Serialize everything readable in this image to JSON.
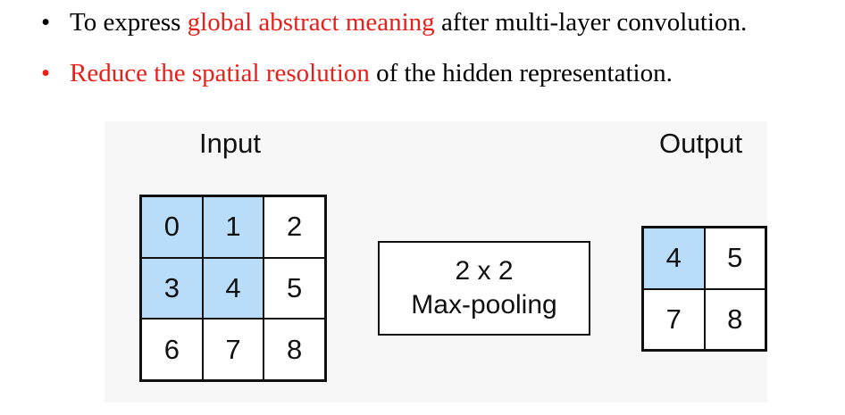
{
  "bullets": [
    {
      "before": "To express ",
      "highlight": "global abstract meaning",
      "after": " after multi-layer convolution."
    },
    {
      "before": "",
      "highlight": "Reduce the spatial resolution",
      "after": " of the hidden representation."
    }
  ],
  "diagram": {
    "input_label": "Input",
    "output_label": "Output",
    "operation_line1": "2 x 2",
    "operation_line2": "Max-pooling",
    "input_cells": [
      "0",
      "1",
      "2",
      "3",
      "4",
      "5",
      "6",
      "7",
      "8"
    ],
    "output_cells": [
      "4",
      "5",
      "7",
      "8"
    ],
    "highlight_color": "#b9dcf8",
    "accent_color": "#e8201a"
  }
}
